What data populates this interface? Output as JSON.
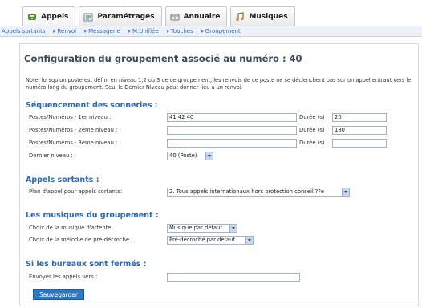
{
  "tabs": [
    {
      "label": "Appels",
      "icon": "phone-icon"
    },
    {
      "label": "Paramétrages",
      "icon": "settings-icon"
    },
    {
      "label": "Annuaire",
      "icon": "directory-icon"
    },
    {
      "label": "Musiques",
      "icon": "music-icon"
    }
  ],
  "subnav": [
    "Appels sortants",
    "Renvoi",
    "Messagerie",
    "M.Unifiée",
    "Touches",
    "Groupement"
  ],
  "title": "Configuration du groupement associé au numéro : 40",
  "note": "Note: lorsqu'un poste est défini en niveau 1,2 ou 3 de ce groupement, les renvois de ce poste ne se déclenchent pas sur un appel entrant vers le numéro long du groupement. Seul le Dernier Niveau peut donner lieu a un renvoi",
  "sections": {
    "sequencement": "Séquencement des sonneries :",
    "sortants": "Appels sortants :",
    "musiques": "Les musiques du groupement :",
    "fermes": "Si les bureaux sont fermés :"
  },
  "rows": {
    "niveau1": {
      "label": "Postes/Numéros - 1er niveau :",
      "value": "41 42 40",
      "duree_label": "Durée (s)",
      "duree": "20"
    },
    "niveau2": {
      "label": "Postes/Numéros - 2ème niveau :",
      "value": "",
      "duree_label": "Durée (s)",
      "duree": "180"
    },
    "niveau3": {
      "label": "Postes/Numéros - 3ème niveau :",
      "value": "",
      "duree_label": "Durée (s)",
      "duree": ""
    },
    "dernier": {
      "label": "Dernier niveau :",
      "value": "40 (Poste)"
    },
    "plan": {
      "label": "Plan d'appel pour appels sortants:",
      "value": "2. Tous appels internationaux hors protection conseill??e"
    },
    "musique_attente": {
      "label": "Choix de la musique d'attente",
      "value": "Musique par défaut"
    },
    "melodie": {
      "label": "Choix de la mélodie de pré-décroché :",
      "value": "Pré-décroché par défaut"
    },
    "envoyer": {
      "label": "Envoyer les appels vers :",
      "value": ""
    }
  },
  "save_label": "Sauvegarder",
  "colors": {
    "accent": "#2a6ab8",
    "button": "#2e77c2",
    "link": "#3366cc"
  }
}
